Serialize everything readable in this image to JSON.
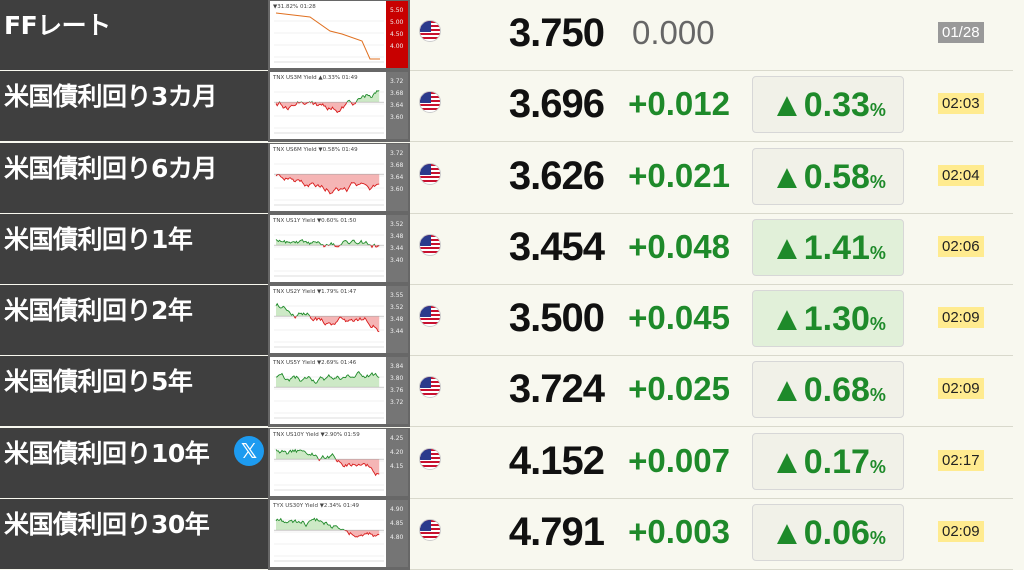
{
  "rows": [
    {
      "label": "FFレート",
      "chart_title": "▼31.82% 01:28",
      "axis": [
        "5.50",
        "5.00",
        "4.50",
        "4.00"
      ],
      "price": "3.750",
      "change": "0.000",
      "pct": "",
      "time": "01/28",
      "chart_kind": "ff",
      "axis_red": true
    },
    {
      "label": "米国債利回り3カ月",
      "chart_title": "TNX US3M Yield ▲0.33% 01:49",
      "axis": [
        "3.72",
        "3.68",
        "3.64",
        "3.60"
      ],
      "price": "3.696",
      "change": "+0.012",
      "pct": "▲0.33",
      "time": "02:03",
      "chart_kind": "mixed",
      "axis_red": false
    },
    {
      "label": "米国債利回り6カ月",
      "chart_title": "TNX US6M Yield ▼0.58% 01:49",
      "axis": [
        "3.72",
        "3.68",
        "3.64",
        "3.60"
      ],
      "price": "3.626",
      "change": "+0.021",
      "pct": "▲0.58",
      "time": "02:04",
      "chart_kind": "mixed2",
      "axis_red": false
    },
    {
      "label": "米国債利回り1年",
      "chart_title": "TNX US1Y Yield ▼0.60% 01:50",
      "axis": [
        "3.52",
        "3.48",
        "3.44",
        "3.40"
      ],
      "price": "3.454",
      "change": "+0.048",
      "pct": "▲1.41",
      "time": "02:06",
      "chart_kind": "down",
      "axis_red": false
    },
    {
      "label": "米国債利回り2年",
      "chart_title": "TNX US2Y Yield ▼1.79% 01:47",
      "axis": [
        "3.55",
        "3.52",
        "3.48",
        "3.44"
      ],
      "price": "3.500",
      "change": "+0.045",
      "pct": "▲1.30",
      "time": "02:09",
      "chart_kind": "down",
      "axis_red": false
    },
    {
      "label": "米国債利回り5年",
      "chart_title": "TNX US5Y Yield ▼2.69% 01:46",
      "axis": [
        "3.84",
        "3.80",
        "3.76",
        "3.72"
      ],
      "price": "3.724",
      "change": "+0.025",
      "pct": "▲0.68",
      "time": "02:09",
      "chart_kind": "down",
      "axis_red": false
    },
    {
      "label": "米国債利回り10年",
      "chart_title": "TNX US10Y Yield ▼2.90% 01:59",
      "axis": [
        "4.25",
        "4.20",
        "4.15"
      ],
      "price": "4.152",
      "change": "+0.007",
      "pct": "▲0.17",
      "time": "02:17",
      "chart_kind": "down",
      "axis_red": false,
      "x_icon": "𝕏"
    },
    {
      "label": "米国債利回り30年",
      "chart_title": "TYX US30Y Yield ▼2.34% 01:49",
      "axis": [
        "4.90",
        "4.85",
        "4.80"
      ],
      "price": "4.791",
      "change": "+0.003",
      "pct": "▲0.06",
      "time": "02:09",
      "chart_kind": "down",
      "axis_red": false
    }
  ],
  "pct_symbol": "%",
  "icons": {
    "flag": "us-flag-icon",
    "x": "x-logo-icon"
  },
  "colors": {
    "up": "#1e8a2a",
    "label_bg": "#3f3f3f",
    "time_bg": "#ffeb8f"
  }
}
